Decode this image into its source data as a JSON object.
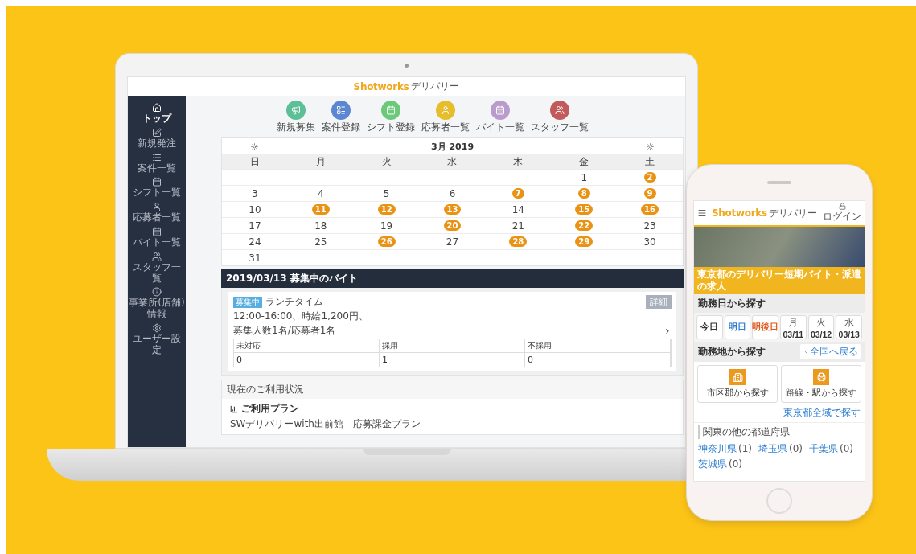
{
  "laptop": {
    "header": {
      "brand": "Shotworks",
      "brand_suffix": "デリバリー"
    },
    "sidebar": {
      "items": [
        {
          "label": "トップ",
          "selected": true
        },
        {
          "label": "新規発注",
          "selected": false
        },
        {
          "label": "案件一覧",
          "selected": false
        },
        {
          "label": "シフト一覧",
          "selected": false
        },
        {
          "label": "応募者一覧",
          "selected": false
        },
        {
          "label": "バイト一覧",
          "selected": false
        },
        {
          "label": "スタッフ一覧",
          "selected": false
        },
        {
          "label": "事業所(店舗)情報",
          "selected": false
        },
        {
          "label": "ユーザー設定",
          "selected": false
        }
      ]
    },
    "shortcuts": [
      {
        "label": "新規募集",
        "color": "#5dbf96"
      },
      {
        "label": "案件登録",
        "color": "#5b86d1"
      },
      {
        "label": "シフト登録",
        "color": "#6cc97a"
      },
      {
        "label": "応募者一覧",
        "color": "#e6bd2a"
      },
      {
        "label": "バイト一覧",
        "color": "#b99ccc"
      },
      {
        "label": "スタッフ一覧",
        "color": "#c2595b"
      }
    ],
    "calendar": {
      "month": "3月 2019",
      "weekdays": [
        "日",
        "月",
        "火",
        "水",
        "木",
        "金",
        "土"
      ],
      "weeks": [
        [
          {
            "kind": "blank"
          },
          {
            "kind": "blank"
          },
          {
            "kind": "blank"
          },
          {
            "kind": "blank"
          },
          {
            "kind": "blank"
          },
          {
            "kind": "day",
            "day": "1",
            "marked": false
          },
          {
            "kind": "day",
            "day": "2",
            "marked": true
          }
        ],
        [
          {
            "kind": "day",
            "day": "3",
            "marked": false
          },
          {
            "kind": "day",
            "day": "4",
            "marked": false
          },
          {
            "kind": "day",
            "day": "5",
            "marked": false
          },
          {
            "kind": "day",
            "day": "6",
            "marked": false
          },
          {
            "kind": "day",
            "day": "7",
            "marked": true
          },
          {
            "kind": "day",
            "day": "8",
            "marked": true
          },
          {
            "kind": "day",
            "day": "9",
            "marked": true
          }
        ],
        [
          {
            "kind": "day",
            "day": "10",
            "marked": false
          },
          {
            "kind": "day",
            "day": "11",
            "marked": true
          },
          {
            "kind": "day",
            "day": "12",
            "marked": true
          },
          {
            "kind": "day",
            "day": "13",
            "marked": true
          },
          {
            "kind": "day",
            "day": "14",
            "marked": false
          },
          {
            "kind": "day",
            "day": "15",
            "marked": true
          },
          {
            "kind": "day",
            "day": "16",
            "marked": true
          }
        ],
        [
          {
            "kind": "day",
            "day": "17",
            "marked": false
          },
          {
            "kind": "day",
            "day": "18",
            "marked": false
          },
          {
            "kind": "day",
            "day": "19",
            "marked": false
          },
          {
            "kind": "day",
            "day": "20",
            "marked": true
          },
          {
            "kind": "day",
            "day": "21",
            "marked": false
          },
          {
            "kind": "day",
            "day": "22",
            "marked": true
          },
          {
            "kind": "day",
            "day": "23",
            "marked": false
          }
        ],
        [
          {
            "kind": "day",
            "day": "24",
            "marked": false
          },
          {
            "kind": "day",
            "day": "25",
            "marked": false
          },
          {
            "kind": "day",
            "day": "26",
            "marked": true
          },
          {
            "kind": "day",
            "day": "27",
            "marked": false
          },
          {
            "kind": "day",
            "day": "28",
            "marked": true
          },
          {
            "kind": "day",
            "day": "29",
            "marked": true
          },
          {
            "kind": "day",
            "day": "30",
            "marked": false
          }
        ],
        [
          {
            "kind": "day",
            "day": "31",
            "marked": false
          },
          {
            "kind": "blank"
          },
          {
            "kind": "blank"
          },
          {
            "kind": "blank"
          },
          {
            "kind": "blank"
          },
          {
            "kind": "blank"
          },
          {
            "kind": "blank"
          }
        ]
      ]
    },
    "posting": {
      "title": "2019/03/13 募集中のバイト",
      "status": "募集中",
      "name": "ランチタイム",
      "detail": "12:00-16:00、時給1,200円、",
      "counts": "募集人数1名/応募者1名",
      "button": "詳細",
      "table": {
        "columns": [
          "未対応",
          "採用",
          "不採用"
        ],
        "rows": [
          [
            "0",
            "1",
            "0"
          ]
        ]
      }
    },
    "usage": {
      "title": "現在のご利用状況",
      "plan_label": "ご利用プラン",
      "plan": "SWデリバリーwith出前館　応募課金プラン"
    }
  },
  "phone": {
    "brand": "Shotworks",
    "brand_suffix": "デリバリー",
    "login": "ログイン",
    "banner": "東京都のデリバリー短期バイト・派遣の求人",
    "date_section": "勤務日から探す",
    "dates": [
      {
        "label": "今日",
        "color": "#333333"
      },
      {
        "label": "明日",
        "color": "#2f7fd0"
      },
      {
        "label": "明後日",
        "color": "#e0591c"
      },
      {
        "weekday": "月",
        "label": "03/11",
        "color": "#333333"
      },
      {
        "weekday": "火",
        "label": "03/12",
        "color": "#333333"
      },
      {
        "weekday": "水",
        "label": "03/13",
        "color": "#333333"
      }
    ],
    "area_section": "勤務地から探す",
    "back_link": "全国へ戻る",
    "search_cards": [
      {
        "kind": "city",
        "label": "市区郡から探す"
      },
      {
        "kind": "train",
        "label": "路線・駅から探す"
      }
    ],
    "all_link": "東京都全域で探す",
    "other_title": "関東の他の都道府県",
    "prefectures": [
      {
        "name": "神奈川県",
        "count": "(1)"
      },
      {
        "name": "埼玉県",
        "count": "(0)"
      },
      {
        "name": "千葉県",
        "count": "(0)"
      },
      {
        "name": "茨城県",
        "count": "(0)"
      }
    ]
  }
}
